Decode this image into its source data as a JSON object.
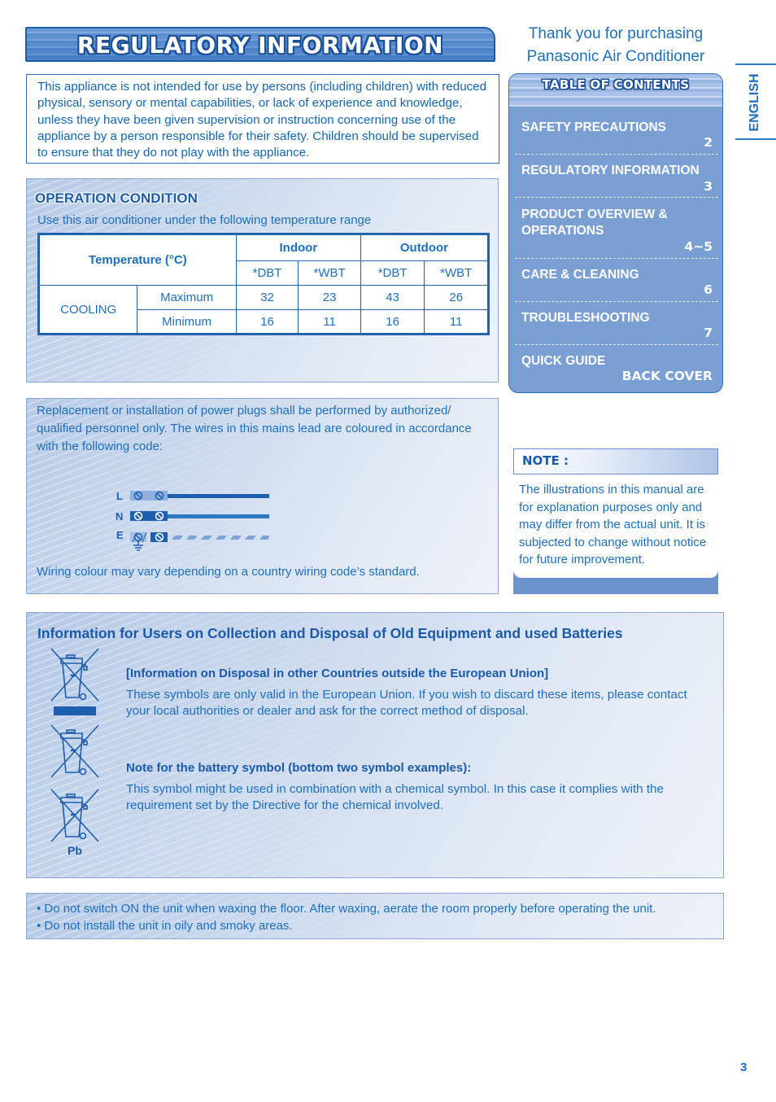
{
  "header": {
    "title": "REGULATORY INFORMATION",
    "thanks_line1": "Thank you for purchasing",
    "thanks_line2": "Panasonic Air Conditioner",
    "language_tab": "ENGLISH"
  },
  "intro": {
    "text": "This appliance is not intended for use by persons (including children) with reduced physical, sensory or mental capabilities, or lack of experience and knowledge, unless they have been given supervision or instruction concerning use of the appliance by a person responsible for their safety. Children should be supervised to ensure that they do not play with the appliance."
  },
  "operation": {
    "heading": "OPERATION CONDITION",
    "subtitle": "Use this air conditioner under the following temperature range",
    "table": {
      "corner": "Temperature (°C)",
      "group_headers": [
        "Indoor",
        "Outdoor"
      ],
      "sub_headers": [
        "*DBT",
        "*WBT",
        "*DBT",
        "*WBT"
      ],
      "mode": "COOLING",
      "rows": [
        {
          "label": "Maximum",
          "values": [
            "32",
            "23",
            "43",
            "26"
          ]
        },
        {
          "label": "Minimum",
          "values": [
            "16",
            "11",
            "16",
            "11"
          ]
        }
      ]
    }
  },
  "wiring": {
    "text": "Replacement or installation of power plugs shall be performed by authorized/ qualified personnel only. The wires in this mains lead are coloured in accordance with the following code:",
    "labels": [
      "L",
      "N",
      "E"
    ],
    "footnote": "Wiring colour may vary depending on a country wiring code’s standard."
  },
  "toc": {
    "title": "TABLE OF CONTENTS",
    "items": [
      {
        "label": "SAFETY PRECAUTIONS",
        "page": "2"
      },
      {
        "label": "REGULATORY INFORMATION",
        "page": "3"
      },
      {
        "label": "PRODUCT OVERVIEW & OPERATIONS",
        "page": "4~5"
      },
      {
        "label": "CARE & CLEANING",
        "page": "6"
      },
      {
        "label": "TROUBLESHOOTING",
        "page": "7"
      },
      {
        "label": "QUICK GUIDE",
        "page": "BACK COVER"
      }
    ]
  },
  "note": {
    "title": "NOTE :",
    "text": "The illustrations in this manual are for explanation purposes only and may differ from the actual unit. It is subjected to change without notice for future improvement."
  },
  "disposal": {
    "heading": "Information for Users on Collection and Disposal of Old Equipment and used Batteries",
    "sub1": "[Information on Disposal in other Countries outside the European Union]",
    "text1": "These symbols are only valid in the European Union. If you wish to discard these items, please contact your local authorities or dealer and ask for the correct method of disposal.",
    "sub2": "Note for the battery symbol (bottom two symbol examples):",
    "text2": "This symbol might be used in combination with a chemical symbol. In this case it complies with the requirement set by the Directive for the chemical involved.",
    "chemical_label": "Pb"
  },
  "bullets": [
    "• Do not switch ON the unit when waxing the floor. After waxing, aerate the room properly before operating the unit.",
    "• Do not install the unit in oily and smoky areas."
  ],
  "page_number": "3",
  "colors": {
    "primary_blue": "#1d6fbd",
    "dark_blue": "#1a5aa8",
    "toc_bg": "#7a9fd3"
  }
}
